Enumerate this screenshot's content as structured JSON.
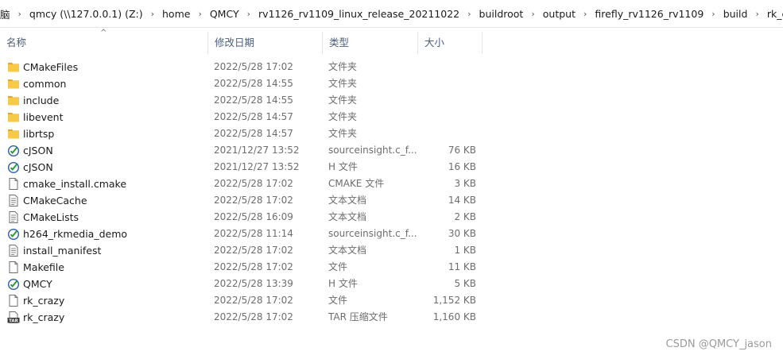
{
  "breadcrumb": [
    "脑",
    "qmcy (\\\\127.0.0.1) (Z:)",
    "home",
    "QMCY",
    "rv1126_rv1109_linux_release_20211022",
    "buildroot",
    "output",
    "firefly_rv1126_rv1109",
    "build",
    "rk_crazy"
  ],
  "breadcrumb_separator": "›",
  "columns": {
    "name": "名称",
    "date": "修改日期",
    "type": "类型",
    "size": "大小",
    "sort_indicator": "^"
  },
  "files": [
    {
      "icon": "folder-icon",
      "name": "CMakeFiles",
      "date": "2022/5/28 17:02",
      "type": "文件夹",
      "size": ""
    },
    {
      "icon": "folder-icon",
      "name": "common",
      "date": "2022/5/28 14:55",
      "type": "文件夹",
      "size": ""
    },
    {
      "icon": "folder-icon",
      "name": "include",
      "date": "2022/5/28 14:55",
      "type": "文件夹",
      "size": ""
    },
    {
      "icon": "folder-icon",
      "name": "libevent",
      "date": "2022/5/28 14:57",
      "type": "文件夹",
      "size": ""
    },
    {
      "icon": "folder-icon",
      "name": "librtsp",
      "date": "2022/5/28 14:57",
      "type": "文件夹",
      "size": ""
    },
    {
      "icon": "sourceinsight-icon",
      "name": "cJSON",
      "date": "2021/12/27 13:52",
      "type": "sourceinsight.c_f...",
      "size": "76 KB"
    },
    {
      "icon": "sourceinsight-icon",
      "name": "cJSON",
      "date": "2021/12/27 13:52",
      "type": "H 文件",
      "size": "16 KB"
    },
    {
      "icon": "document-icon",
      "name": "cmake_install.cmake",
      "date": "2022/5/28 17:02",
      "type": "CMAKE 文件",
      "size": "3 KB"
    },
    {
      "icon": "text-document-icon",
      "name": "CMakeCache",
      "date": "2022/5/28 17:02",
      "type": "文本文档",
      "size": "14 KB"
    },
    {
      "icon": "text-document-icon",
      "name": "CMakeLists",
      "date": "2022/5/28 16:09",
      "type": "文本文档",
      "size": "2 KB"
    },
    {
      "icon": "sourceinsight-icon",
      "name": "h264_rkmedia_demo",
      "date": "2022/5/28 11:14",
      "type": "sourceinsight.c_f...",
      "size": "30 KB"
    },
    {
      "icon": "text-document-icon",
      "name": "install_manifest",
      "date": "2022/5/28 17:02",
      "type": "文本文档",
      "size": "1 KB"
    },
    {
      "icon": "document-icon",
      "name": "Makefile",
      "date": "2022/5/28 17:02",
      "type": "文件",
      "size": "11 KB"
    },
    {
      "icon": "sourceinsight-icon",
      "name": "QMCY",
      "date": "2022/5/28 13:39",
      "type": "H 文件",
      "size": "5 KB"
    },
    {
      "icon": "document-icon",
      "name": "rk_crazy",
      "date": "2022/5/28 17:02",
      "type": "文件",
      "size": "1,152 KB"
    },
    {
      "icon": "tar-archive-icon",
      "name": "rk_crazy",
      "date": "2022/5/28 17:02",
      "type": "TAR 压缩文件",
      "size": "1,160 KB"
    }
  ],
  "watermark": "CSDN @QMCY_jason",
  "tar_label": "TAR",
  "colors": {
    "folder": "#f7c948",
    "folder_dark": "#e2a82b",
    "si_green": "#2e9b3a",
    "si_blue": "#2a5db0",
    "header_text": "#4c607a"
  }
}
